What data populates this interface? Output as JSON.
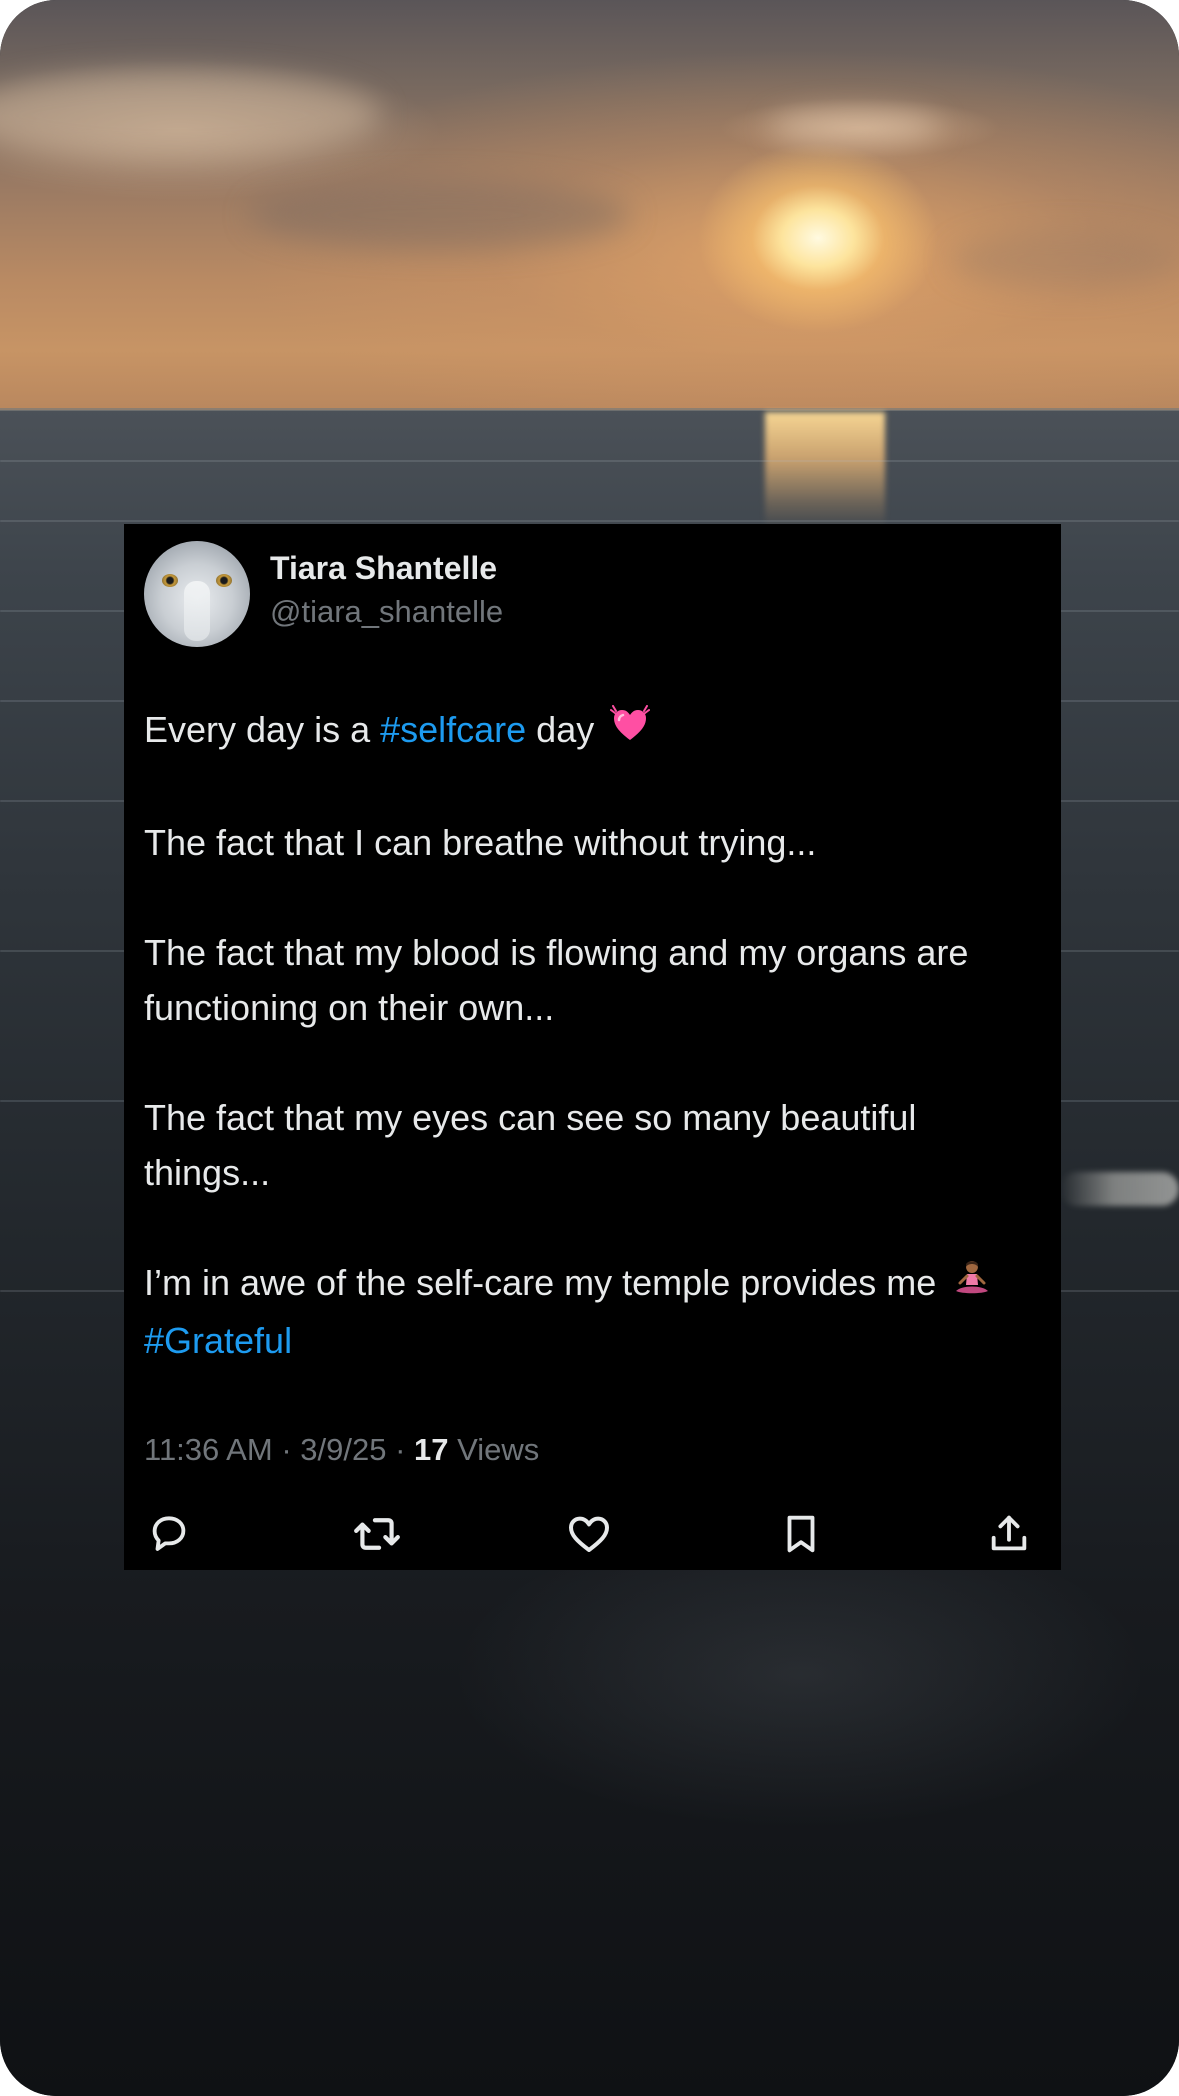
{
  "tweet": {
    "display_name": "Tiara Shantelle",
    "handle": "@tiara_shantelle",
    "paragraphs": [
      {
        "prefix": "Every day is a ",
        "hashtag": "#selfcare",
        "suffix": " day",
        "emoji": "growing-heart"
      },
      {
        "text": "The fact that I can breathe without trying..."
      },
      {
        "text": "The fact that my blood is flowing and my organs are functioning on their own..."
      },
      {
        "text": "The fact that my eyes can see so many beautiful things..."
      },
      {
        "prefix": "I’m in awe of the self-care my temple provides me",
        "emoji": "person-in-lotus-position",
        "hashtag": "#Grateful"
      }
    ],
    "time": "11:36 AM",
    "date": "3/9/25",
    "separator": "·",
    "views_count": "17",
    "views_label": "Views"
  },
  "actions": [
    {
      "name": "reply",
      "icon": "reply-icon"
    },
    {
      "name": "repost",
      "icon": "repost-icon"
    },
    {
      "name": "like",
      "icon": "heart-icon"
    },
    {
      "name": "bookmark",
      "icon": "bookmark-icon"
    },
    {
      "name": "share",
      "icon": "share-icon"
    }
  ],
  "colors": {
    "card_background": "#000000",
    "primary_text": "#e7e9ea",
    "secondary_text": "#71767b",
    "hashtag": "#1d9bf0",
    "heart_emoji": "#ff4fa3"
  }
}
